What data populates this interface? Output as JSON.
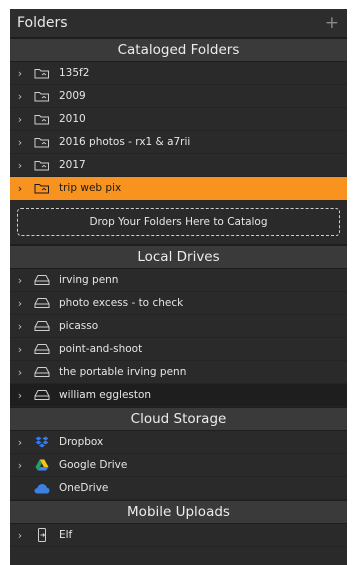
{
  "header": {
    "title": "Folders",
    "add_label": "+"
  },
  "cataloged": {
    "title": "Cataloged Folders",
    "items": [
      {
        "label": "135f2"
      },
      {
        "label": "2009"
      },
      {
        "label": "2010"
      },
      {
        "label": "2016 photos - rx1 & a7rii"
      },
      {
        "label": "2017"
      },
      {
        "label": "trip web pix",
        "selected": true
      }
    ],
    "drop_label": "Drop Your Folders Here to Catalog"
  },
  "local": {
    "title": "Local Drives",
    "items": [
      {
        "label": "irving penn"
      },
      {
        "label": "photo excess - to check"
      },
      {
        "label": "picasso"
      },
      {
        "label": "point-and-shoot"
      },
      {
        "label": "the portable irving penn"
      },
      {
        "label": "william eggleston"
      }
    ]
  },
  "cloud": {
    "title": "Cloud Storage",
    "items": [
      {
        "label": "Dropbox",
        "icon": "dropbox-icon"
      },
      {
        "label": "Google Drive",
        "icon": "google-drive-icon"
      },
      {
        "label": "OneDrive",
        "icon": "onedrive-icon"
      }
    ]
  },
  "mobile": {
    "title": "Mobile Uploads",
    "items": [
      {
        "label": "Elf",
        "icon": "mobile-device-icon"
      }
    ]
  },
  "colors": {
    "panel": "#2a2a2a",
    "section_header": "#3a3a3a",
    "selected": "#f7931e",
    "dropbox": "#2f7df6",
    "onedrive": "#3b82e0"
  }
}
